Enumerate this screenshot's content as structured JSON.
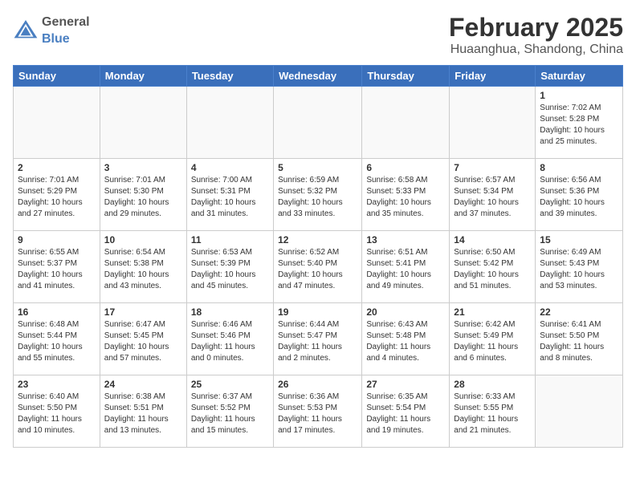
{
  "header": {
    "logo_general": "General",
    "logo_blue": "Blue",
    "month_year": "February 2025",
    "location": "Huaanghua, Shandong, China"
  },
  "days_of_week": [
    "Sunday",
    "Monday",
    "Tuesday",
    "Wednesday",
    "Thursday",
    "Friday",
    "Saturday"
  ],
  "weeks": [
    {
      "days": [
        {
          "num": "",
          "info": ""
        },
        {
          "num": "",
          "info": ""
        },
        {
          "num": "",
          "info": ""
        },
        {
          "num": "",
          "info": ""
        },
        {
          "num": "",
          "info": ""
        },
        {
          "num": "",
          "info": ""
        },
        {
          "num": "1",
          "info": "Sunrise: 7:02 AM\nSunset: 5:28 PM\nDaylight: 10 hours and 25 minutes."
        }
      ]
    },
    {
      "days": [
        {
          "num": "2",
          "info": "Sunrise: 7:01 AM\nSunset: 5:29 PM\nDaylight: 10 hours and 27 minutes."
        },
        {
          "num": "3",
          "info": "Sunrise: 7:01 AM\nSunset: 5:30 PM\nDaylight: 10 hours and 29 minutes."
        },
        {
          "num": "4",
          "info": "Sunrise: 7:00 AM\nSunset: 5:31 PM\nDaylight: 10 hours and 31 minutes."
        },
        {
          "num": "5",
          "info": "Sunrise: 6:59 AM\nSunset: 5:32 PM\nDaylight: 10 hours and 33 minutes."
        },
        {
          "num": "6",
          "info": "Sunrise: 6:58 AM\nSunset: 5:33 PM\nDaylight: 10 hours and 35 minutes."
        },
        {
          "num": "7",
          "info": "Sunrise: 6:57 AM\nSunset: 5:34 PM\nDaylight: 10 hours and 37 minutes."
        },
        {
          "num": "8",
          "info": "Sunrise: 6:56 AM\nSunset: 5:36 PM\nDaylight: 10 hours and 39 minutes."
        }
      ]
    },
    {
      "days": [
        {
          "num": "9",
          "info": "Sunrise: 6:55 AM\nSunset: 5:37 PM\nDaylight: 10 hours and 41 minutes."
        },
        {
          "num": "10",
          "info": "Sunrise: 6:54 AM\nSunset: 5:38 PM\nDaylight: 10 hours and 43 minutes."
        },
        {
          "num": "11",
          "info": "Sunrise: 6:53 AM\nSunset: 5:39 PM\nDaylight: 10 hours and 45 minutes."
        },
        {
          "num": "12",
          "info": "Sunrise: 6:52 AM\nSunset: 5:40 PM\nDaylight: 10 hours and 47 minutes."
        },
        {
          "num": "13",
          "info": "Sunrise: 6:51 AM\nSunset: 5:41 PM\nDaylight: 10 hours and 49 minutes."
        },
        {
          "num": "14",
          "info": "Sunrise: 6:50 AM\nSunset: 5:42 PM\nDaylight: 10 hours and 51 minutes."
        },
        {
          "num": "15",
          "info": "Sunrise: 6:49 AM\nSunset: 5:43 PM\nDaylight: 10 hours and 53 minutes."
        }
      ]
    },
    {
      "days": [
        {
          "num": "16",
          "info": "Sunrise: 6:48 AM\nSunset: 5:44 PM\nDaylight: 10 hours and 55 minutes."
        },
        {
          "num": "17",
          "info": "Sunrise: 6:47 AM\nSunset: 5:45 PM\nDaylight: 10 hours and 57 minutes."
        },
        {
          "num": "18",
          "info": "Sunrise: 6:46 AM\nSunset: 5:46 PM\nDaylight: 11 hours and 0 minutes."
        },
        {
          "num": "19",
          "info": "Sunrise: 6:44 AM\nSunset: 5:47 PM\nDaylight: 11 hours and 2 minutes."
        },
        {
          "num": "20",
          "info": "Sunrise: 6:43 AM\nSunset: 5:48 PM\nDaylight: 11 hours and 4 minutes."
        },
        {
          "num": "21",
          "info": "Sunrise: 6:42 AM\nSunset: 5:49 PM\nDaylight: 11 hours and 6 minutes."
        },
        {
          "num": "22",
          "info": "Sunrise: 6:41 AM\nSunset: 5:50 PM\nDaylight: 11 hours and 8 minutes."
        }
      ]
    },
    {
      "days": [
        {
          "num": "23",
          "info": "Sunrise: 6:40 AM\nSunset: 5:50 PM\nDaylight: 11 hours and 10 minutes."
        },
        {
          "num": "24",
          "info": "Sunrise: 6:38 AM\nSunset: 5:51 PM\nDaylight: 11 hours and 13 minutes."
        },
        {
          "num": "25",
          "info": "Sunrise: 6:37 AM\nSunset: 5:52 PM\nDaylight: 11 hours and 15 minutes."
        },
        {
          "num": "26",
          "info": "Sunrise: 6:36 AM\nSunset: 5:53 PM\nDaylight: 11 hours and 17 minutes."
        },
        {
          "num": "27",
          "info": "Sunrise: 6:35 AM\nSunset: 5:54 PM\nDaylight: 11 hours and 19 minutes."
        },
        {
          "num": "28",
          "info": "Sunrise: 6:33 AM\nSunset: 5:55 PM\nDaylight: 11 hours and 21 minutes."
        },
        {
          "num": "",
          "info": ""
        }
      ]
    }
  ]
}
